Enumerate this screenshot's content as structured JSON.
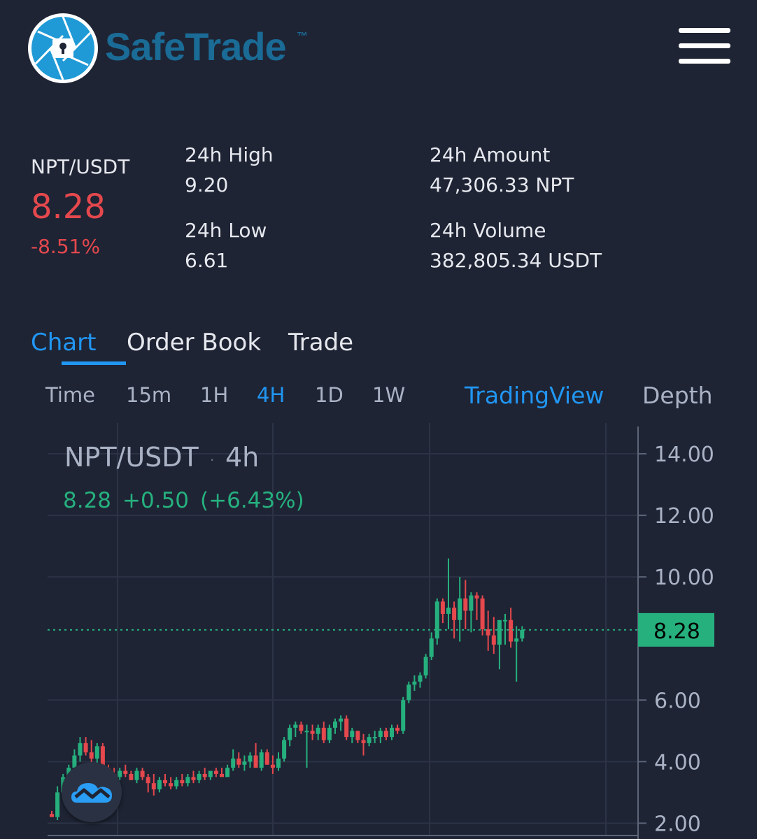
{
  "header": {
    "brand": "SafeTrade",
    "trademark": "™"
  },
  "ticker": {
    "pair": "NPT/USDT",
    "price": "8.28",
    "change": "-8.51%",
    "high_label": "24h High",
    "high_value": "9.20",
    "low_label": "24h Low",
    "low_value": "6.61",
    "amount_label": "24h Amount",
    "amount_value": "47,306.33 NPT",
    "volume_label": "24h Volume",
    "volume_value": "382,805.34 USDT"
  },
  "tabs": [
    {
      "label": "Chart",
      "active": true
    },
    {
      "label": "Order Book",
      "active": false
    },
    {
      "label": "Trade",
      "active": false
    }
  ],
  "intervals": [
    {
      "label": "Time",
      "active": false
    },
    {
      "label": "15m",
      "active": false
    },
    {
      "label": "1H",
      "active": false
    },
    {
      "label": "4H",
      "active": true
    },
    {
      "label": "1D",
      "active": false
    },
    {
      "label": "1W",
      "active": false
    }
  ],
  "views": {
    "tradingview": "TradingView",
    "depth": "Depth"
  },
  "colors": {
    "up": "#26b07e",
    "down": "#e5484d",
    "accent": "#2196f3",
    "background": "#1e2434"
  },
  "chart_legend": {
    "pair": "NPT/USDT",
    "separator": "·",
    "interval": "4h",
    "last": "8.28",
    "change": "+0.50",
    "change_pct": "(+6.43%)"
  },
  "chart_data": {
    "type": "candlestick",
    "ylim": [
      1.6,
      15.0
    ],
    "yticks": [
      "14.00",
      "12.00",
      "10.00",
      "6.00",
      "4.00",
      "2.00"
    ],
    "ytick_values": [
      14,
      12,
      10,
      6,
      4,
      2
    ],
    "last_price": 8.28,
    "last_price_label": "8.28",
    "grid": true,
    "candles": [
      [
        2.3,
        2.4,
        2.2,
        2.2
      ],
      [
        2.2,
        3.2,
        2.1,
        3.0
      ],
      [
        3.0,
        3.6,
        2.9,
        3.5
      ],
      [
        3.5,
        3.9,
        3.3,
        3.8
      ],
      [
        3.8,
        4.4,
        3.6,
        4.2
      ],
      [
        4.2,
        4.8,
        4.0,
        4.6
      ],
      [
        4.6,
        4.8,
        4.2,
        4.3
      ],
      [
        4.3,
        4.7,
        3.0,
        4.1
      ],
      [
        4.1,
        4.6,
        3.8,
        4.5
      ],
      [
        4.5,
        4.6,
        3.6,
        3.8
      ],
      [
        3.8,
        3.9,
        3.3,
        3.6
      ],
      [
        3.6,
        3.8,
        3.3,
        3.5
      ],
      [
        3.5,
        3.8,
        3.4,
        3.7
      ],
      [
        3.7,
        3.9,
        3.5,
        3.6
      ],
      [
        3.6,
        3.7,
        3.4,
        3.4
      ],
      [
        3.4,
        3.8,
        3.3,
        3.7
      ],
      [
        3.7,
        3.8,
        3.4,
        3.5
      ],
      [
        3.5,
        3.6,
        3.0,
        3.3
      ],
      [
        3.3,
        3.6,
        2.9,
        3.1
      ],
      [
        3.1,
        3.5,
        3.0,
        3.4
      ],
      [
        3.4,
        3.6,
        3.2,
        3.3
      ],
      [
        3.3,
        3.5,
        3.1,
        3.2
      ],
      [
        3.2,
        3.5,
        3.1,
        3.4
      ],
      [
        3.4,
        3.6,
        3.2,
        3.3
      ],
      [
        3.3,
        3.6,
        3.2,
        3.5
      ],
      [
        3.5,
        3.7,
        3.3,
        3.4
      ],
      [
        3.4,
        3.7,
        3.3,
        3.6
      ],
      [
        3.6,
        3.8,
        3.4,
        3.5
      ],
      [
        3.5,
        3.7,
        3.4,
        3.7
      ],
      [
        3.7,
        3.8,
        3.5,
        3.6
      ],
      [
        3.6,
        3.8,
        3.5,
        3.5
      ],
      [
        3.5,
        3.9,
        3.5,
        3.8
      ],
      [
        3.8,
        4.4,
        3.7,
        4.1
      ],
      [
        4.1,
        4.3,
        3.8,
        3.9
      ],
      [
        3.9,
        4.2,
        3.7,
        4.0
      ],
      [
        4.0,
        4.3,
        3.8,
        4.2
      ],
      [
        4.2,
        4.6,
        4.0,
        3.8
      ],
      [
        3.8,
        4.4,
        3.7,
        4.3
      ],
      [
        4.3,
        4.4,
        3.9,
        3.9
      ],
      [
        3.9,
        4.2,
        3.6,
        3.8
      ],
      [
        3.8,
        4.3,
        3.7,
        4.1
      ],
      [
        4.1,
        4.8,
        4.0,
        4.7
      ],
      [
        4.7,
        5.2,
        4.5,
        5.1
      ],
      [
        5.1,
        5.3,
        4.8,
        5.2
      ],
      [
        5.2,
        5.3,
        4.9,
        5.0
      ],
      [
        5.0,
        5.2,
        3.8,
        5.0
      ],
      [
        5.0,
        5.2,
        4.7,
        4.9
      ],
      [
        4.9,
        5.2,
        4.7,
        5.1
      ],
      [
        5.1,
        5.3,
        4.6,
        4.7
      ],
      [
        4.7,
        5.2,
        4.6,
        5.1
      ],
      [
        5.1,
        5.4,
        4.9,
        5.3
      ],
      [
        5.3,
        5.5,
        5.0,
        5.4
      ],
      [
        5.4,
        5.5,
        4.7,
        4.8
      ],
      [
        4.8,
        5.1,
        4.6,
        5.0
      ],
      [
        5.0,
        5.0,
        4.6,
        4.7
      ],
      [
        4.7,
        4.9,
        4.2,
        4.6
      ],
      [
        4.6,
        4.9,
        4.5,
        4.8
      ],
      [
        4.8,
        5.0,
        4.6,
        4.8
      ],
      [
        4.8,
        5.1,
        4.6,
        5.0
      ],
      [
        5.0,
        5.1,
        4.7,
        4.8
      ],
      [
        4.8,
        5.2,
        4.7,
        5.1
      ],
      [
        5.1,
        5.2,
        4.9,
        5.0
      ],
      [
        5.0,
        6.1,
        4.9,
        6.0
      ],
      [
        6.0,
        6.6,
        5.9,
        6.5
      ],
      [
        6.5,
        6.8,
        6.3,
        6.6
      ],
      [
        6.6,
        6.9,
        6.4,
        6.8
      ],
      [
        6.8,
        7.5,
        6.7,
        7.4
      ],
      [
        7.4,
        8.2,
        7.3,
        8.0
      ],
      [
        8.0,
        9.3,
        7.8,
        9.2
      ],
      [
        9.2,
        9.3,
        8.5,
        8.8
      ],
      [
        8.8,
        10.6,
        8.3,
        9.0
      ],
      [
        9.0,
        9.2,
        8.0,
        8.6
      ],
      [
        8.6,
        10.0,
        7.9,
        9.3
      ],
      [
        9.3,
        9.9,
        8.3,
        8.9
      ],
      [
        8.9,
        9.5,
        8.2,
        9.4
      ],
      [
        9.4,
        9.5,
        8.6,
        9.3
      ],
      [
        9.3,
        9.4,
        8.1,
        8.3
      ],
      [
        8.3,
        8.9,
        7.6,
        8.1
      ],
      [
        8.1,
        8.7,
        7.5,
        7.8
      ],
      [
        7.8,
        8.5,
        7.0,
        8.6
      ],
      [
        8.6,
        8.8,
        7.8,
        8.6
      ],
      [
        8.6,
        9.0,
        7.7,
        7.9
      ],
      [
        7.9,
        8.4,
        6.6,
        8.0
      ],
      [
        8.0,
        8.4,
        7.9,
        8.28
      ]
    ]
  }
}
